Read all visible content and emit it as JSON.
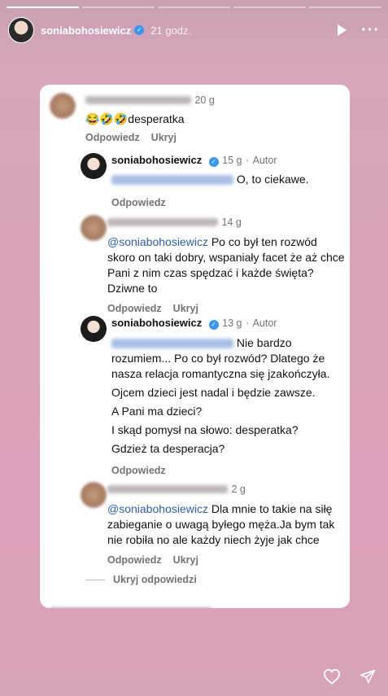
{
  "story": {
    "username": "soniabohosiewicz",
    "time": "21 godz.",
    "progress_segments": 5,
    "progress_done": 1
  },
  "comments": [
    {
      "time": "20 g",
      "text": "😂🤣🤣desperatka",
      "reply": "Odpowiedz",
      "hide": "Ukryj"
    },
    {
      "name": "soniabohosiewicz",
      "time": "15 g",
      "author": "Autor",
      "text": "O, to ciekawe.",
      "reply": "Odpowiedz"
    },
    {
      "time": "14 g",
      "mention": "@soniabohosiewicz",
      "text": "Po co był ten rozwód skoro on taki dobry, wspaniały facet że aż chce Pani z nim czas spędzać i każde święta?Dziwne to",
      "reply": "Odpowiedz",
      "hide": "Ukryj"
    },
    {
      "name": "soniabohosiewicz",
      "time": "13 g",
      "author": "Autor",
      "lines": [
        "Nie bardzo",
        "rozumiem... Po co był rozwód? Dlatego że",
        "nasza relacja romantyczna się jzakończyła.",
        "Ojcem dzieci jest nadal i będzie zawsze.",
        "A Pani ma dzieci?",
        "I skąd pomysł na słowo: desperatka?",
        "Gdzież ta desperacja?"
      ],
      "reply": "Odpowiedz"
    },
    {
      "time": "2 g",
      "mention": "@soniabohosiewicz",
      "text": "Dla mnie to takie na siłę zabieganie o uwagą byłego męża.Ja bym tak nie robiła no ale każdy niech żyje jak chce",
      "reply": "Odpowiedz",
      "hide": "Ukryj"
    }
  ],
  "hide_replies": "Ukryj odpowiedzi"
}
